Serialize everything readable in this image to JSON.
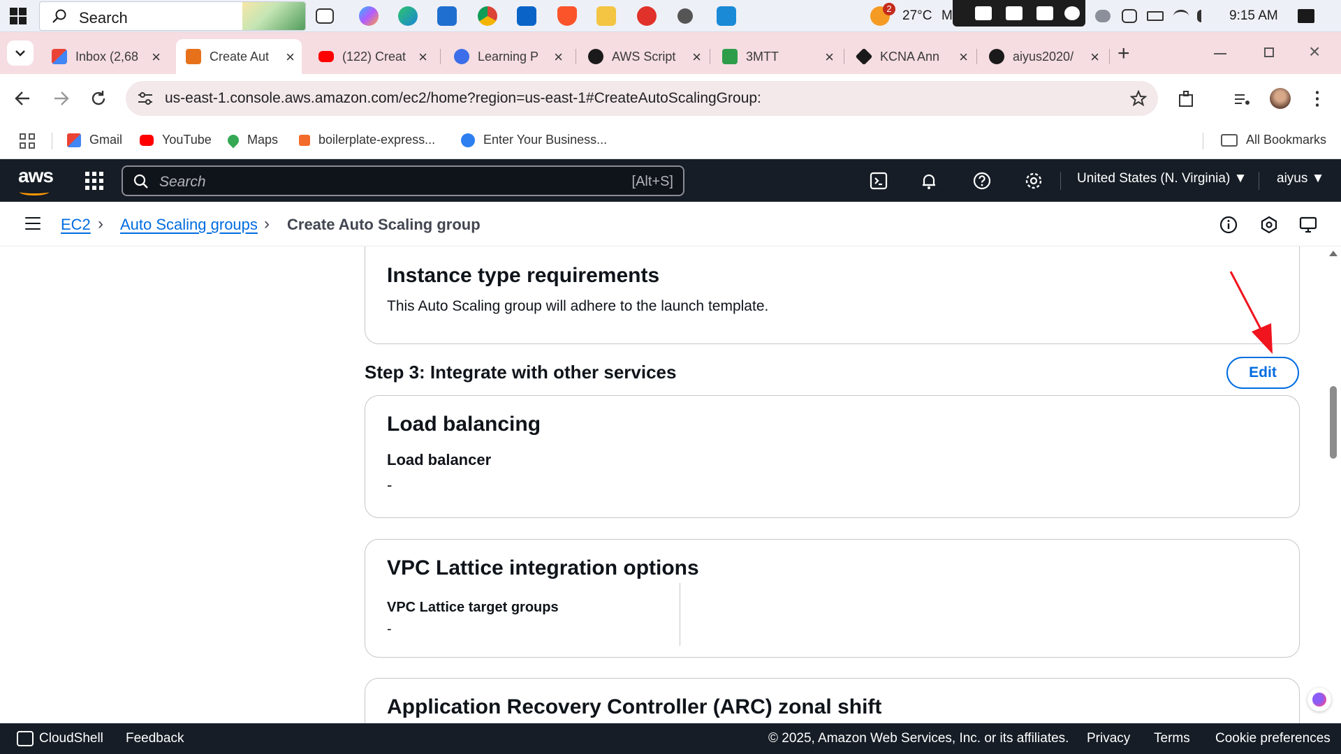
{
  "taskbar": {
    "search_label": "Search",
    "weather_temp": "27°C",
    "weather_extra": "M",
    "weather_badge": "2",
    "time": "9:15 AM"
  },
  "tabs": [
    {
      "label": "Inbox (2,68",
      "favicon": "gmail-icon",
      "active": false
    },
    {
      "label": "Create Aut",
      "favicon": "aws-icon",
      "active": true
    },
    {
      "label": "(122) Creat",
      "favicon": "youtube-icon",
      "active": false
    },
    {
      "label": "Learning P",
      "favicon": "learning-icon",
      "active": false
    },
    {
      "label": "AWS Script",
      "favicon": "openai-icon",
      "active": false
    },
    {
      "label": "3MTT",
      "favicon": "3mtt-icon",
      "active": false
    },
    {
      "label": "KCNA Ann",
      "favicon": "kcna-icon",
      "active": false
    },
    {
      "label": "aiyus2020/",
      "favicon": "github-icon",
      "active": false
    }
  ],
  "address": {
    "url": "us-east-1.console.aws.amazon.com/ec2/home?region=us-east-1#CreateAutoScalingGroup:"
  },
  "bookmarks": {
    "items": [
      "Gmail",
      "YouTube",
      "Maps",
      "boilerplate-express...",
      "Enter Your Business..."
    ],
    "all_label": "All Bookmarks"
  },
  "aws_header": {
    "logo": "aws",
    "search_placeholder": "Search",
    "search_shortcut": "[Alt+S]",
    "region": "United States (N. Virginia) ▼",
    "user": "aiyus ▼"
  },
  "breadcrumb": {
    "ec2": "EC2",
    "asg": "Auto Scaling groups",
    "current": "Create Auto Scaling group"
  },
  "main": {
    "instance_card": {
      "title": "Instance type requirements",
      "description": "This Auto Scaling group will adhere to the launch template."
    },
    "step3_title": "Step 3: Integrate with other services",
    "edit_label": "Edit",
    "load_balancing": {
      "title": "Load balancing",
      "key": "Load balancer",
      "value": "-"
    },
    "vpc_lattice": {
      "title": "VPC Lattice integration options",
      "key": "VPC Lattice target groups",
      "value": "-"
    },
    "arc": {
      "title": "Application Recovery Controller (ARC) zonal shift"
    }
  },
  "footer": {
    "cloudshell": "CloudShell",
    "feedback": "Feedback",
    "copyright": "© 2025, Amazon Web Services, Inc. or its affiliates.",
    "privacy": "Privacy",
    "terms": "Terms",
    "cookie": "Cookie preferences"
  },
  "colors": {
    "aws_dark": "#161d26",
    "link_blue": "#006ce0",
    "annotation_red": "#f0141e",
    "tab_strip": "#f6dde2"
  }
}
